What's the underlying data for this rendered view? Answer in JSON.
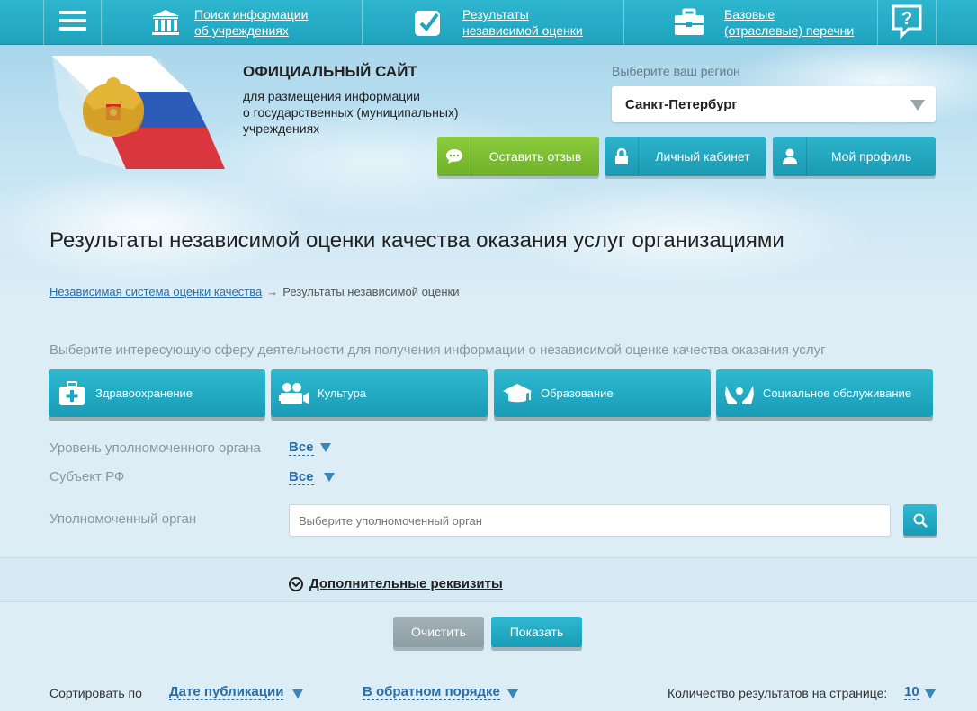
{
  "topnav": {
    "menu_icon": "hamburger-icon",
    "items": [
      {
        "label_line1": "Поиск информации",
        "label_line2": "об учреждениях",
        "icon": "institution-icon"
      },
      {
        "label_line1": "Результаты",
        "label_line2": "независимой оценки",
        "icon": "checkbox-icon"
      },
      {
        "label_line1": "Базовые",
        "label_line2": "(отраслевые) перечни",
        "icon": "briefcase-icon"
      }
    ],
    "help_icon": "help-question-icon"
  },
  "header": {
    "title": "ОФИЦИАЛЬНЫЙ САЙТ",
    "subtitle_line1": "для размещения информации",
    "subtitle_line2": "о государственных (муниципальных)",
    "subtitle_line3": "учреждениях",
    "region_label": "Выберите ваш регион",
    "region_value": "Санкт-Петербург",
    "buttons": {
      "feedback": "Оставить отзыв",
      "cabinet": "Личный кабинет",
      "profile": "Мой профиль"
    }
  },
  "page": {
    "title": "Результаты независимой оценки качества оказания услуг организациями",
    "breadcrumb": {
      "link": "Независимая система оценки качества",
      "separator": "→",
      "current": "Результаты независимой оценки"
    },
    "sphere_prompt": "Выберите интересующую сферу деятельности для получения информации о независимой оценке качества оказания услуг",
    "spheres": [
      {
        "label": "Здравоохранение",
        "icon": "medical-kit-icon"
      },
      {
        "label": "Культура",
        "icon": "movie-camera-icon"
      },
      {
        "label": "Образование",
        "icon": "graduation-cap-icon"
      },
      {
        "label": "Социальное обслуживание",
        "icon": "caring-hands-icon"
      }
    ]
  },
  "filters": {
    "level_label": "Уровень уполномоченного органа",
    "level_value": "Все",
    "subject_label": "Субъект РФ",
    "subject_value": "Все",
    "authority_label": "Уполномоченный орган",
    "authority_placeholder": "Выберите уполномоченный орган",
    "extra_label": "Дополнительные реквизиты",
    "clear_button": "Очистить",
    "show_button": "Показать"
  },
  "sorting": {
    "sort_label": "Сортировать по",
    "sort_field": "Дате публикации",
    "sort_order": "В обратном порядке",
    "count_label": "Количество результатов на странице:",
    "count_value": "10"
  }
}
